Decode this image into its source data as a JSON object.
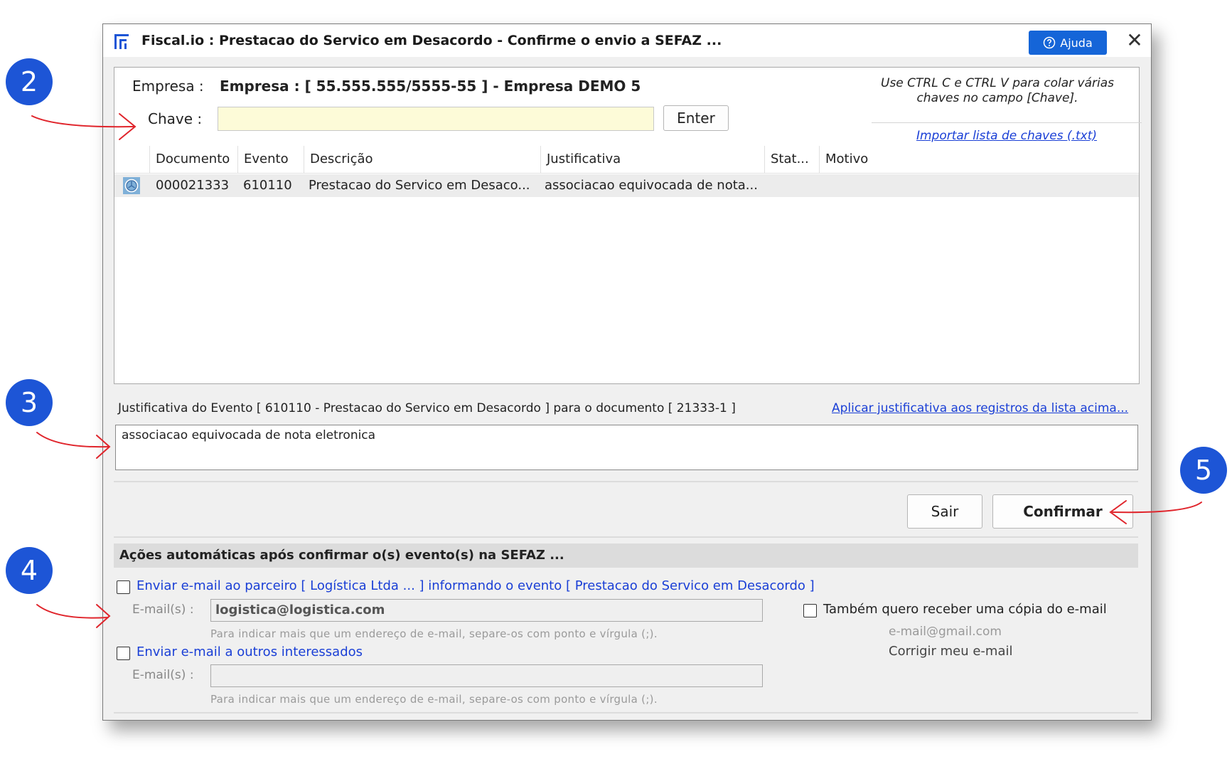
{
  "window": {
    "title": "Fiscal.io : Prestacao do Servico em Desacordo - Confirme o envio a SEFAZ ...",
    "help_label": "Ajuda",
    "close_glyph": "✕"
  },
  "header": {
    "empresa_label": "Empresa :",
    "empresa_value": "Empresa : [ 55.555.555/5555-55 ] - Empresa DEMO 5",
    "chave_label": "Chave :",
    "chave_value": "",
    "enter_label": "Enter",
    "hint": "Use CTRL C e CTRL V para colar várias chaves no campo [Chave].",
    "import_link": "Importar lista de chaves (.txt)"
  },
  "grid": {
    "columns": [
      "Documento",
      "Evento",
      "Descrição",
      "Justificativa",
      "Stat...",
      "Motivo"
    ],
    "rows": [
      {
        "icon": "clock-icon",
        "documento": "000021333",
        "evento": "610110",
        "descricao": "Prestacao do Servico em Desaco...",
        "justificativa": "associacao equivocada de nota...",
        "status": "",
        "motivo": ""
      }
    ]
  },
  "justificativa": {
    "label": "Justificativa do Evento [ 610110 - Prestacao do Servico em Desacordo ] para o documento [ 21333-1 ]",
    "apply_link": "Aplicar justificativa aos registros da lista acima...",
    "text": "associacao equivocada de nota eletronica"
  },
  "buttons": {
    "sair": "Sair",
    "confirmar": "Confirmar"
  },
  "actions": {
    "heading": "Ações automáticas após confirmar o(s) evento(s) na SEFAZ ...",
    "partner_email_label": "Enviar e-mail ao parceiro [ Logística Ltda ... ] informando o evento [ Prestacao do Servico em Desacordo ]",
    "emails_label": "E-mail(s) :",
    "partner_email_value": "logistica@logistica.com",
    "emails_hint": "Para indicar mais que um endereço de e-mail, separe-os com ponto e vírgula (;).",
    "copy_label": "Também quero receber uma cópia do e-mail",
    "my_email": "e-mail@gmail.com",
    "fix_email": "Corrigir meu e-mail",
    "others_email_label": "Enviar e-mail a outros interessados",
    "others_email_value": ""
  },
  "callouts": [
    "2",
    "3",
    "4",
    "5"
  ],
  "colors": {
    "accent": "#1d55d6",
    "link": "#1a3fd6",
    "arrow": "#e0242b",
    "chave_bg": "#fdfbd8"
  }
}
